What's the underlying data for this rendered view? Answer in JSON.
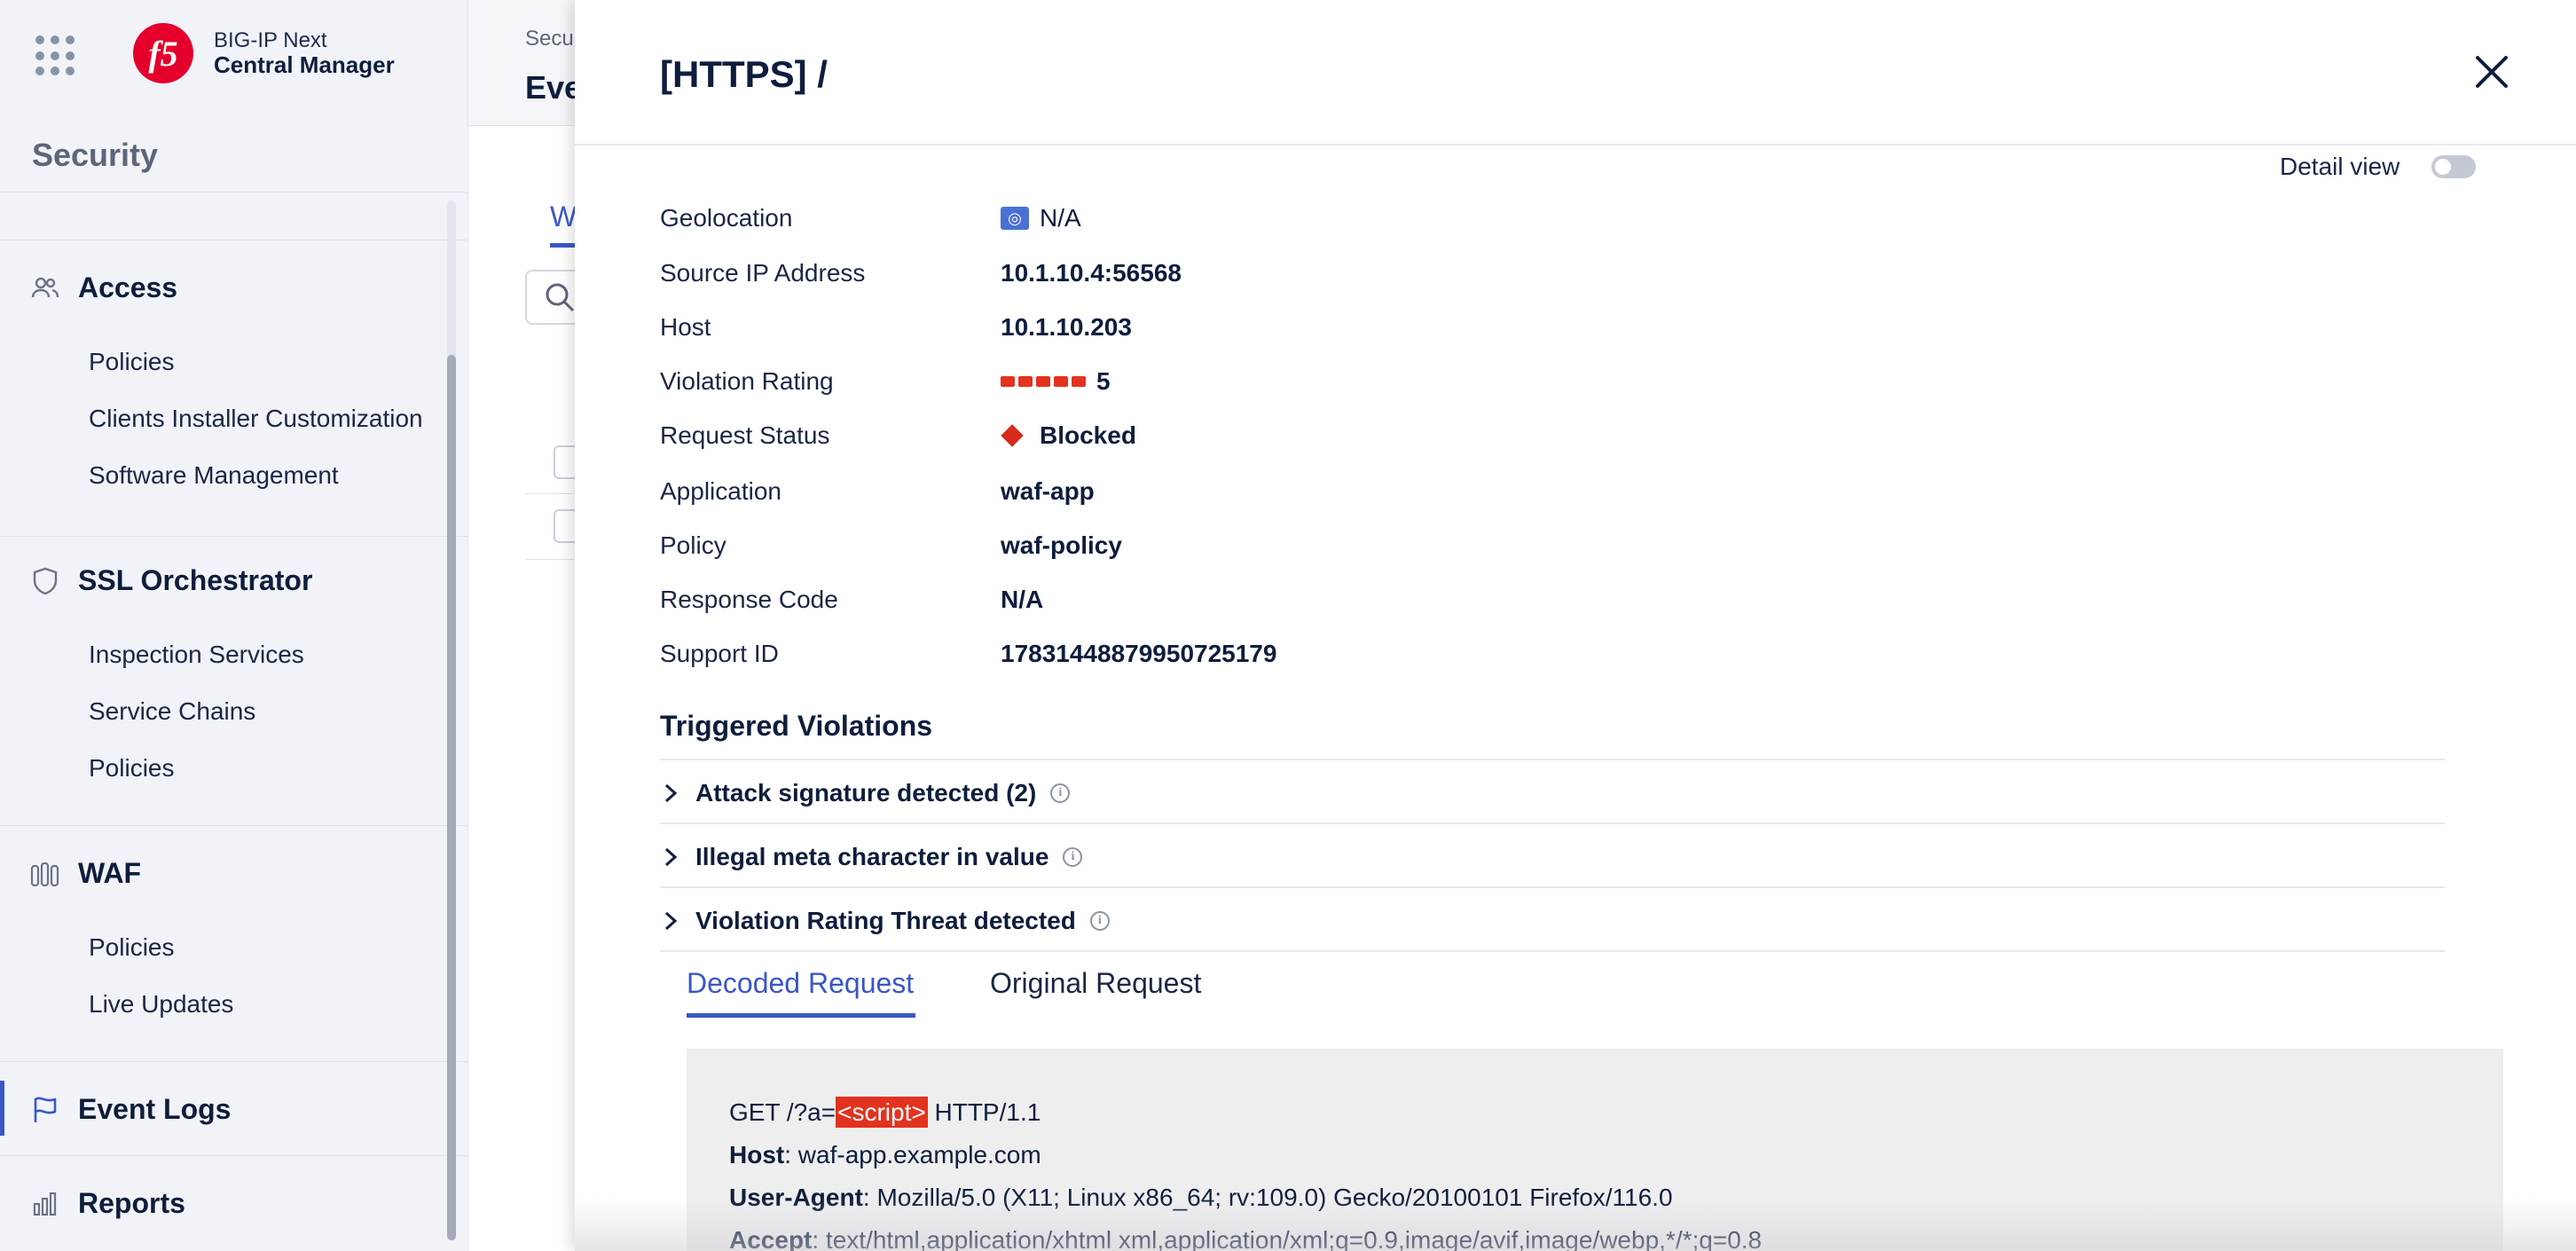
{
  "brand": {
    "line1": "BIG-IP Next",
    "line2": "Central Manager",
    "logo_text": "f5",
    "logo_color": "#e4002b"
  },
  "sidebar": {
    "section_title": "Security",
    "groups": [
      {
        "label": "Access",
        "icon": "users-icon",
        "items": [
          "Policies",
          "Clients Installer Customization",
          "Software Management"
        ]
      },
      {
        "label": "SSL Orchestrator",
        "icon": "shield-icon",
        "items": [
          "Inspection Services",
          "Service Chains",
          "Policies"
        ]
      },
      {
        "label": "WAF",
        "icon": "waf-icon",
        "items": [
          "Policies",
          "Live Updates"
        ]
      }
    ],
    "event_logs": {
      "label": "Event Logs",
      "icon": "flag-icon",
      "active": true
    },
    "reports": {
      "label": "Reports",
      "icon": "bar-chart-icon"
    }
  },
  "background": {
    "breadcrumb": "Secu",
    "title": "Eve",
    "tab": "W"
  },
  "drawer": {
    "title": "[HTTPS] /",
    "detail_view_label": "Detail view",
    "detail_view_on": false,
    "fields": {
      "geolocation": {
        "label": "Geolocation",
        "value": "N/A"
      },
      "source_ip": {
        "label": "Source IP Address",
        "value": "10.1.10.4:56568"
      },
      "host": {
        "label": "Host",
        "value": "10.1.10.203"
      },
      "violation_rating": {
        "label": "Violation Rating",
        "value": "5",
        "bars": 5
      },
      "request_status": {
        "label": "Request Status",
        "value": "Blocked"
      },
      "application": {
        "label": "Application",
        "value": "waf-app"
      },
      "policy": {
        "label": "Policy",
        "value": "waf-policy"
      },
      "response_code": {
        "label": "Response Code",
        "value": "N/A"
      },
      "support_id": {
        "label": "Support ID",
        "value": "17831448879950725179"
      }
    },
    "triggered_violations": {
      "title": "Triggered Violations",
      "items": [
        "Attack signature detected (2)",
        "Illegal meta character in value",
        "Violation Rating Threat detected"
      ]
    },
    "request_tabs": {
      "active": "Decoded Request",
      "inactive": "Original Request"
    },
    "request": {
      "line1_prefix": "GET /?a=",
      "line1_highlight": "<script>",
      "line1_suffix": " HTTP/1.1",
      "host_key": "Host",
      "host_value": ": waf-app.example.com",
      "ua_key": "User-Agent",
      "ua_value": ": Mozilla/5.0 (X11; Linux x86_64; rv:109.0) Gecko/20100101 Firefox/116.0",
      "accept_key": "Accept",
      "accept_value": ": text/html,application/xhtml xml,application/xml;q=0.9,image/avif,image/webp,*/*;q=0.8"
    }
  },
  "colors": {
    "accent": "#3a56c9",
    "danger": "#e3321d",
    "text": "#0f1d3d",
    "sidebar_bg": "#f1f3f8"
  }
}
